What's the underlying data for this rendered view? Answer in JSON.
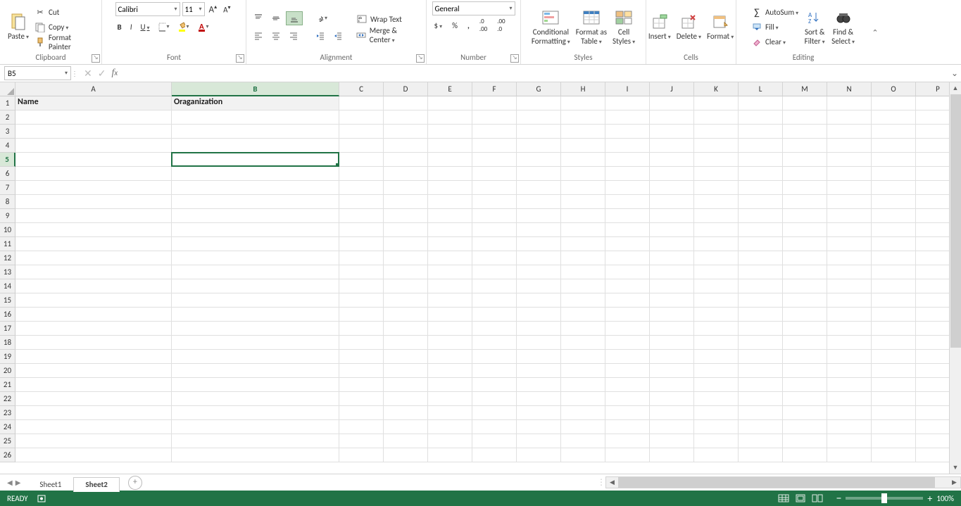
{
  "clipboard": {
    "paste": "Paste",
    "cut": "Cut",
    "copy": "Copy",
    "fp": "Format Painter",
    "group": "Clipboard"
  },
  "font": {
    "name": "Calibri",
    "size": "11",
    "group": "Font"
  },
  "alignment": {
    "wrap": "Wrap Text",
    "merge": "Merge & Center",
    "group": "Alignment"
  },
  "number": {
    "format": "General",
    "group": "Number"
  },
  "styles": {
    "cf": "Conditional",
    "cf2": "Formatting",
    "ft": "Format as",
    "ft2": "Table",
    "cs": "Cell",
    "cs2": "Styles",
    "group": "Styles"
  },
  "cells": {
    "insert": "Insert",
    "delete": "Delete",
    "format": "Format",
    "group": "Cells"
  },
  "editing": {
    "autosum": "AutoSum",
    "fill": "Fill",
    "clear": "Clear",
    "sort": "Sort &",
    "sort2": "Filter",
    "find": "Find &",
    "find2": "Select",
    "group": "Editing"
  },
  "namebox": "B5",
  "cols_narrow": [
    "C",
    "D",
    "E",
    "F",
    "G",
    "H",
    "I",
    "J",
    "K",
    "L",
    "M",
    "N",
    "O",
    "P"
  ],
  "data": {
    "A1": "Name",
    "B1": "Oraganization"
  },
  "tabs": {
    "s1": "Sheet1",
    "s2": "Sheet2"
  },
  "status": {
    "ready": "READY",
    "zoom": "100%"
  }
}
